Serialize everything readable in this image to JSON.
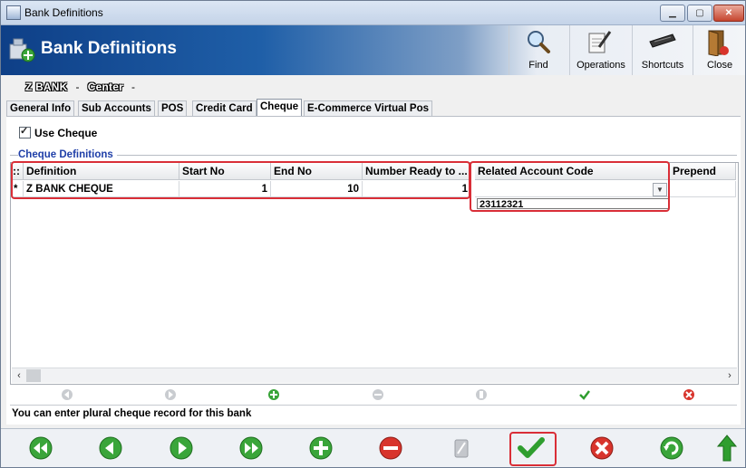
{
  "window": {
    "title": "Bank Definitions",
    "min_icon": "minimize-icon",
    "max_icon": "maximize-icon",
    "close_icon": "close-icon"
  },
  "header": {
    "title": "Bank Definitions",
    "toolbar": [
      {
        "label": "Find",
        "icon": "magnifier-icon"
      },
      {
        "label": "Operations",
        "icon": "document-pen-icon"
      },
      {
        "label": "Shortcuts",
        "icon": "keyboard-icon"
      },
      {
        "label": "Close",
        "icon": "door-exit-icon"
      }
    ]
  },
  "breadcrumb": {
    "bank": "Z BANK",
    "separator": "-",
    "branch": "Center",
    "trailing": "-"
  },
  "tabs": [
    "General Info",
    "Sub Accounts",
    "POS",
    "Credit Card",
    "Cheque",
    "E-Commerce Virtual Pos"
  ],
  "active_tab": "Cheque",
  "cheque": {
    "use_cheque_label": "Use Cheque",
    "use_cheque_checked": true,
    "group_label": "Cheque Definitions",
    "columns": [
      "Definition",
      "Start No",
      "End No",
      "Number Ready to ...",
      "Related Account Code",
      "Prepend"
    ],
    "row_marker": "*",
    "header_marker": "::",
    "row": {
      "definition": "Z BANK CHEQUE",
      "start_no": "1",
      "end_no": "10",
      "number_ready": "1",
      "related_account_code": "",
      "prepend": ""
    },
    "dropdown_option": "23112321",
    "info_text": "You can enter plural cheque record for this bank"
  },
  "grid_nav_icons": [
    "first-record-icon",
    "previous-record-icon",
    "add-record-icon",
    "delete-record-icon",
    "edit-record-icon",
    "confirm-icon",
    "cancel-icon"
  ],
  "bottom_toolbar_icons": [
    "first-icon",
    "previous-icon",
    "next-icon",
    "last-icon",
    "add-icon",
    "delete-icon",
    "edit-icon",
    "save-icon",
    "cancel-icon",
    "refresh-icon",
    "up-arrow-icon"
  ],
  "colors": {
    "header_dark": "#0e3f87",
    "accent_green": "#2f9e2f",
    "accent_red": "#d92e37",
    "group_label_blue": "#1f3fa8"
  }
}
